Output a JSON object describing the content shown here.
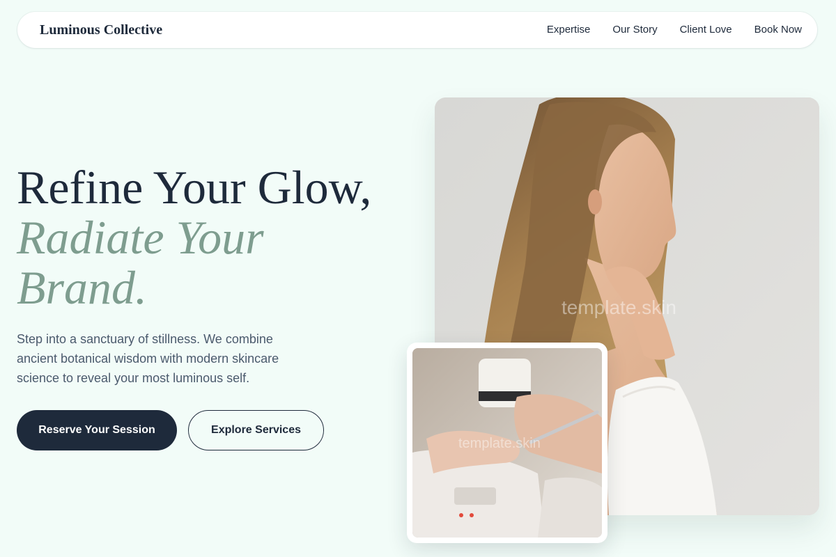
{
  "brand": {
    "name": "Luminous Collective"
  },
  "nav": {
    "links": [
      "Expertise",
      "Our Story",
      "Client Love",
      "Book Now"
    ]
  },
  "hero": {
    "title_line1": "Refine Your Glow,",
    "title_line2": "Radiate Your",
    "title_line3": "Brand.",
    "description": "Step into a sanctuary of stillness. We combine ancient botanical wisdom with modern skincare science to reveal your most luminous self.",
    "primary_cta": "Reserve Your Session",
    "secondary_cta": "Explore Services"
  },
  "images": {
    "main_watermark": "template.skin",
    "card_watermark": "template.skin"
  },
  "colors": {
    "background": "#f2fcf8",
    "navy": "#1e2a3b",
    "sage_accent": "#7e9d8f",
    "body_text": "#4b5a6d"
  }
}
